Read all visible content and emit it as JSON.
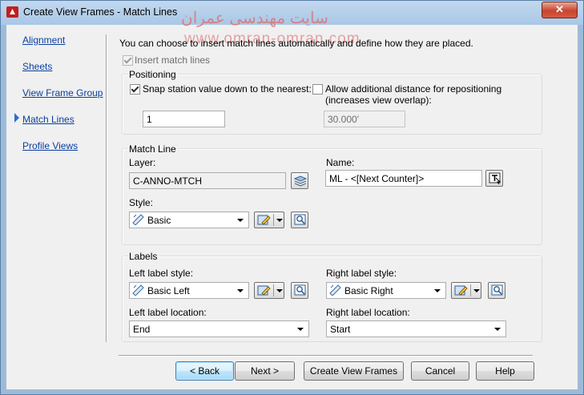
{
  "window": {
    "title": "Create View Frames - Match Lines",
    "close_glyph": "✕"
  },
  "watermark": {
    "line1": "سایت مهندسی عمران",
    "line2": "www.omran-omran.com"
  },
  "nav": {
    "items": [
      {
        "label": "Alignment"
      },
      {
        "label": "Sheets"
      },
      {
        "label": "View Frame Group"
      },
      {
        "label": "Match Lines",
        "active": true
      },
      {
        "label": "Profile Views"
      }
    ]
  },
  "intro": "You can choose to insert match lines automatically and define how they are placed.",
  "insert_match_lines": {
    "label": "Insert match lines",
    "checked": true,
    "enabled": false
  },
  "positioning": {
    "legend": "Positioning",
    "snap": {
      "label": "Snap station value down to the nearest:",
      "checked": true,
      "value": "1"
    },
    "allow": {
      "label_line1": "Allow additional distance for repositioning",
      "label_line2": "(increases view overlap):",
      "checked": false,
      "value": "30.000'"
    }
  },
  "match_line": {
    "legend": "Match Line",
    "layer_label": "Layer:",
    "layer_value": "C-ANNO-MTCH",
    "name_label": "Name:",
    "name_value": "ML - <[Next Counter]>",
    "style_label": "Style:",
    "style_value": "Basic"
  },
  "labels": {
    "legend": "Labels",
    "left_style_label": "Left label style:",
    "left_style_value": "Basic Left",
    "right_style_label": "Right label style:",
    "right_style_value": "Basic Right",
    "left_location_label": "Left label location:",
    "left_location_value": "End",
    "right_location_label": "Right label location:",
    "right_location_value": "Start"
  },
  "buttons": {
    "back": "< Back",
    "next": "Next >",
    "create": "Create View Frames",
    "cancel": "Cancel",
    "help": "Help"
  },
  "colors": {
    "link": "#0b3fa1",
    "active_arrow": "#2d6bd2",
    "close": "#c7452f"
  }
}
